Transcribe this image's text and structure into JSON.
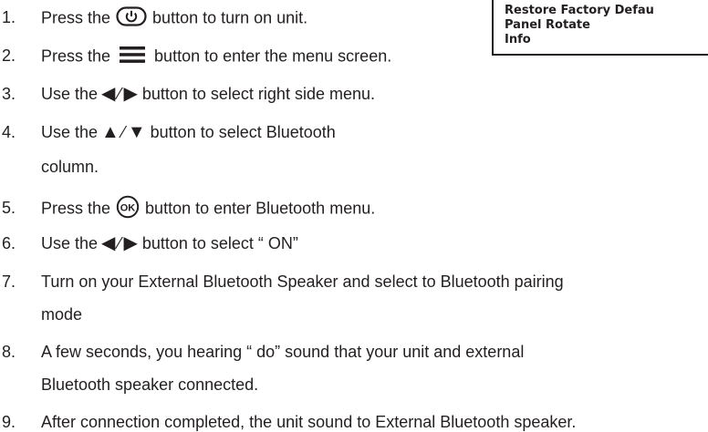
{
  "menu_panel": {
    "items": [
      "Restore Factory Defau",
      "Panel Rotate",
      "Info"
    ]
  },
  "steps": [
    {
      "num": "1.",
      "pre": "Press the",
      "post": "button to turn on unit.",
      "icon": "power-icon"
    },
    {
      "num": "2.",
      "pre": "Press the",
      "post": "button to enter the menu screen.",
      "icon": "menu-icon"
    },
    {
      "num": "3.",
      "pre": "Use the",
      "post": "button to select right side menu.",
      "icon": "left-right-arrows-icon"
    },
    {
      "num": "4.",
      "pre": "Use the",
      "post": "button to select Bluetooth",
      "cont": "column.",
      "icon": "up-down-arrows-icon"
    },
    {
      "num": "5.",
      "pre": "Press the",
      "post": "button to enter Bluetooth menu.",
      "icon": "ok-icon"
    },
    {
      "num": "6.",
      "pre": "Use the",
      "post": "button to select “ ON”",
      "icon": "left-right-arrows-icon"
    },
    {
      "num": "7.",
      "text": "Turn on your External Bluetooth Speaker and select to Bluetooth pairing",
      "cont": "mode"
    },
    {
      "num": "8.",
      "text": "A few seconds, you hearing “ do” sound that your unit and external",
      "cont": "Bluetooth speaker connected."
    },
    {
      "num": "9.",
      "text": "After connection completed, the unit sound to External Bluetooth speaker."
    }
  ],
  "glyphs": {
    "left": "◀",
    "right": "▶",
    "up": "▲",
    "down": "▼",
    "slash": "⁄"
  },
  "colors": {
    "text": "#231f20",
    "background": "#ffffff"
  }
}
